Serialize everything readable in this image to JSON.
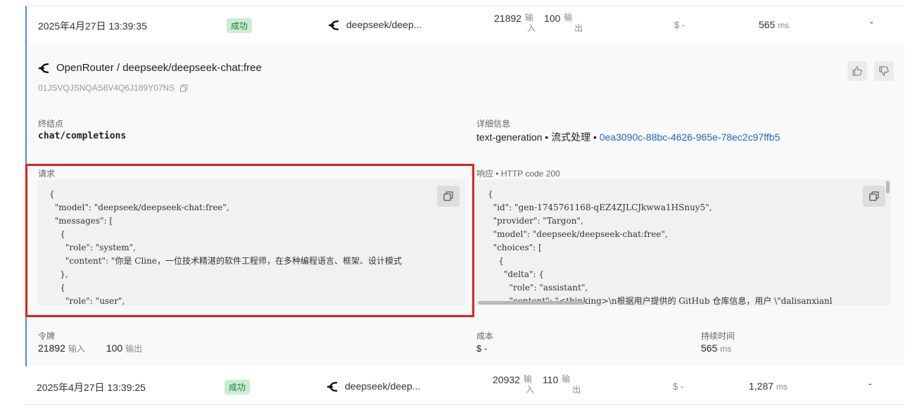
{
  "rows": [
    {
      "time": "2025年4月27日 13:39:35",
      "status": "成功",
      "model": "deepseek/deep...",
      "tokens_in": "21892",
      "tokens_in_unit_1": "输",
      "tokens_in_unit_2": "入",
      "tokens_out": "100",
      "tokens_out_unit_1": "输",
      "tokens_out_unit_2": "出",
      "cost": "$ -",
      "latency": "565",
      "latency_unit": "ms",
      "extra": "-"
    },
    {
      "time": "2025年4月27日 13:39:25",
      "status": "成功",
      "model": "deepseek/deep...",
      "tokens_in": "20932",
      "tokens_in_unit_1": "输",
      "tokens_in_unit_2": "入",
      "tokens_out": "110",
      "tokens_out_unit_1": "输",
      "tokens_out_unit_2": "出",
      "cost": "$ -",
      "latency": "1,287",
      "latency_unit": "ms",
      "extra": "-"
    }
  ],
  "detail": {
    "title": "OpenRouter / deepseek/deepseek-chat:free",
    "id": "01JSVQJSNQAS6V4Q6J189Y07NS",
    "endpoint_label": "终结点",
    "endpoint": "chat/completions",
    "info_label": "详细信息",
    "info_prefix": "text-generation • 流式处理 • ",
    "info_link": "0ea3090c-88bc-4626-965e-78ec2c97ffb5",
    "request_label": "请求",
    "response_label": "响应",
    "response_code": " • HTTP code 200",
    "request_body": "{\n  \"model\": \"deepseek/deepseek-chat:free\",\n  \"messages\": [\n    {\n      \"role\": \"system\",\n      \"content\": \"你是 Cline，一位技术精湛的软件工程师，在多种编程语言、框架、设计模式\n    },\n    {\n      \"role\": \"user\",",
    "response_body": "{\n  \"id\": \"gen-1745761168-qEZ4ZJLCJkwwa1HSnuy5\",\n  \"provider\": \"Targon\",\n  \"model\": \"deepseek/deepseek-chat:free\",\n  \"choices\": [\n    {\n      \"delta\": {\n        \"role\": \"assistant\",\n        \"content\": \"<thinking>\\n根据用户提供的 GitHub 仓库信息，用户 \\\"dalisanxianl",
    "tokens_label": "令牌",
    "tokens_in": "21892",
    "tokens_in_unit": "输入",
    "tokens_out": "100",
    "tokens_out_unit": "输出",
    "cost_label": "成本",
    "cost": "$ -",
    "duration_label": "持续时间",
    "duration": "565",
    "duration_unit": "ms"
  },
  "icons": {
    "provider": "openrouter-logo-icon",
    "copy": "copy-icon",
    "like": "thumbs-up-icon",
    "dislike": "thumbs-down-icon"
  },
  "colors": {
    "accent": "#4a8ad8",
    "success_bg": "#c8edd0",
    "link": "#2563c9",
    "highlight": "#e0201b"
  }
}
